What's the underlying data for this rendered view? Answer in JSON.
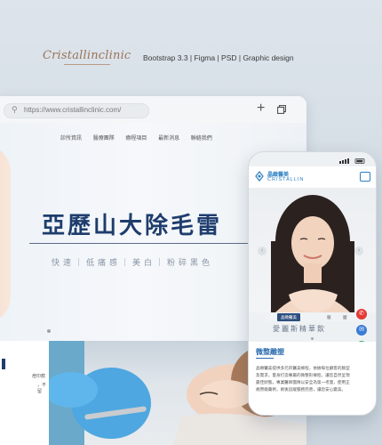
{
  "header": {
    "brand": "Cristallinclinic",
    "tech": "Bootstrap 3.3 | Figma | PSD | Graphic design"
  },
  "browser": {
    "url": "https://www.cristallinclinic.com/",
    "nav": [
      "診所資訊",
      "醫療團隊",
      "療程項目",
      "最新消息",
      "聯絡我們"
    ],
    "hero_title": "亞歷山大除毛雷",
    "hero_sub": "快速｜低痛感｜美白｜粉碎黑色",
    "lower_text": [
      "痘印痕",
      "，不留"
    ]
  },
  "phone": {
    "logo_zh": "晶緻醫美",
    "logo_en": "CRISTALLIN",
    "tags": [
      "晶緻醫美",
      "服",
      "國"
    ],
    "hero_text": "愛麗斯精華飲",
    "section_title": "微整雕塑",
    "section_body": "晶緻醫美提供多元的醫美療程，依據每位顧客的臉型及需求，量身打造專屬的微整形療程，讓您自然呈現最佳狀態。專業醫師團隊以安全為第一考量，使用正規原廠藥劑，術後追蹤服務完善，讓您安心變美。",
    "social": [
      {
        "icon": "phone-icon",
        "color": "#e53935"
      },
      {
        "icon": "mail-icon",
        "color": "#3a7bd5"
      },
      {
        "icon": "line-icon",
        "color": "#21b34a"
      },
      {
        "icon": "facebook-icon",
        "color": "#2d5fb0"
      }
    ]
  }
}
